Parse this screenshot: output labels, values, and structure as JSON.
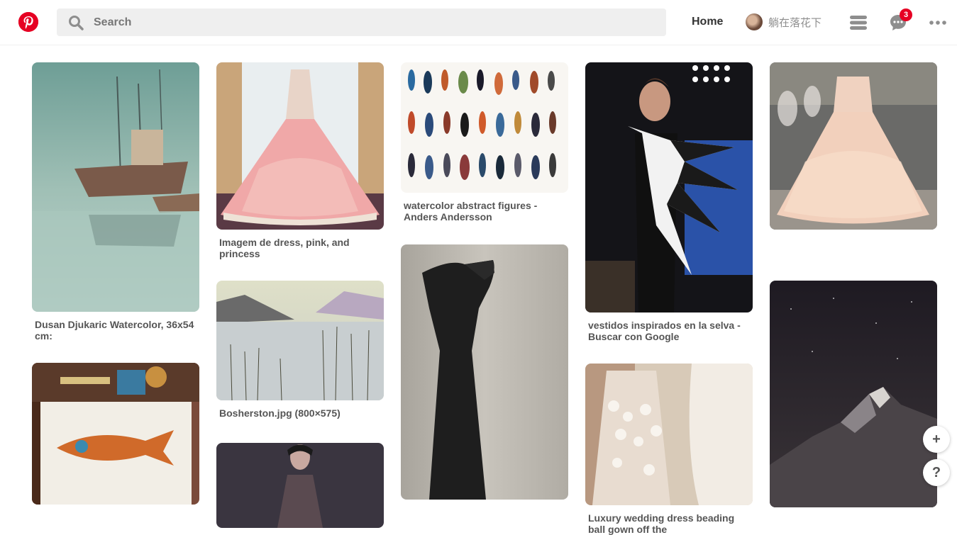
{
  "header": {
    "search_placeholder": "Search",
    "home_label": "Home",
    "username": "躺在落花下",
    "notification_count": "3"
  },
  "pins": [
    {
      "caption": "Dusan Djukaric Watercolor, 36x54 cm:"
    },
    {
      "caption": "Imagem de dress, pink, and princess"
    },
    {
      "caption": "Bosherston.jpg (800×575)"
    },
    {
      "caption": ""
    },
    {
      "caption": "watercolor abstract figures - Anders Andersson"
    },
    {
      "caption": ""
    },
    {
      "caption": "vestidos inspirados en la selva - Buscar con Google"
    },
    {
      "caption": ""
    },
    {
      "caption": "Luxury wedding dress beading ball gown off the"
    },
    {
      "caption": ""
    },
    {
      "caption": ""
    }
  ],
  "floating": {
    "add_label": "+",
    "help_label": "?"
  },
  "colors": {
    "brand": "#e60023",
    "search_bg": "#efefef"
  }
}
